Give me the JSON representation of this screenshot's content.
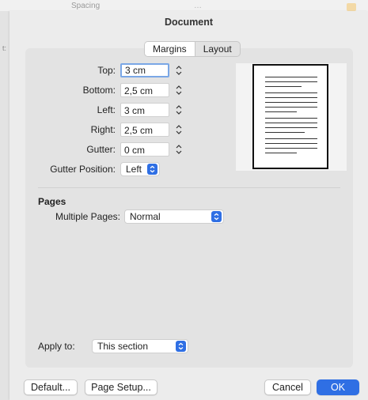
{
  "background": {
    "peek_text": "Spacing",
    "peek_text2": "…",
    "edge_text": "t:"
  },
  "dialog": {
    "title": "Document",
    "tabs": [
      {
        "label": "Margins",
        "selected": true
      },
      {
        "label": "Layout",
        "selected": false
      }
    ]
  },
  "margins": {
    "top": {
      "label": "Top:",
      "value": "3 cm"
    },
    "bottom": {
      "label": "Bottom:",
      "value": "2,5 cm"
    },
    "left": {
      "label": "Left:",
      "value": "3 cm"
    },
    "right": {
      "label": "Right:",
      "value": "2,5 cm"
    },
    "gutter": {
      "label": "Gutter:",
      "value": "0 cm"
    },
    "gutter_position": {
      "label": "Gutter Position:",
      "value": "Left"
    }
  },
  "pages": {
    "heading": "Pages",
    "multiple_pages": {
      "label": "Multiple Pages:",
      "value": "Normal"
    }
  },
  "apply_to": {
    "label": "Apply to:",
    "value": "This section"
  },
  "buttons": {
    "default": "Default...",
    "page_setup": "Page Setup...",
    "cancel": "Cancel",
    "ok": "OK"
  },
  "colors": {
    "accent": "#2f6fe4",
    "focus_ring": "#7aa7e6"
  }
}
